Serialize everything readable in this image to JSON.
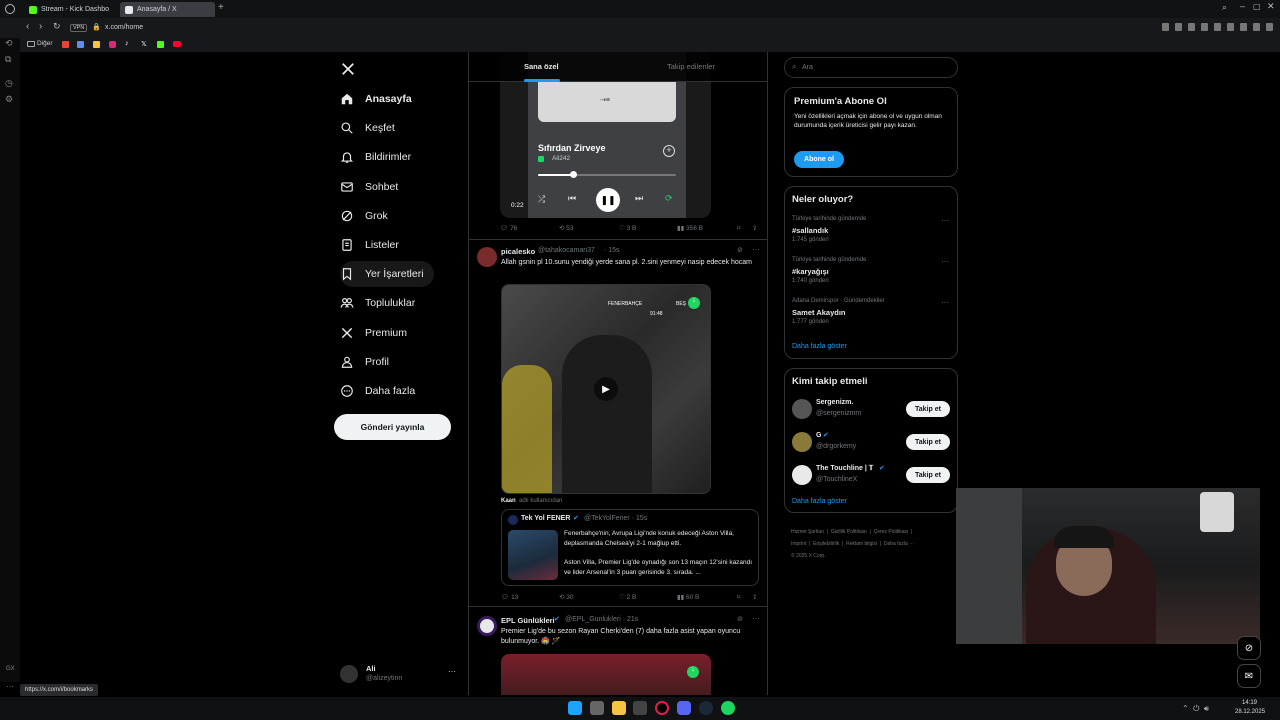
{
  "browser": {
    "tabs": [
      {
        "label": "Stream - Kick Dashbo",
        "favicon_color": "#53fc18"
      },
      {
        "label": "Anasayfa / X",
        "favicon_color": "#e7e9ea"
      }
    ],
    "url": "x.com/home",
    "vpn_badge": "VPN",
    "bookmarks_folder": "Diğer",
    "status_url": "https://x.com/i/bookmarks"
  },
  "nav": {
    "items": [
      {
        "label": "Anasayfa",
        "icon": "home-icon"
      },
      {
        "label": "Keşfet",
        "icon": "search-icon"
      },
      {
        "label": "Bildirimler",
        "icon": "bell-icon"
      },
      {
        "label": "Sohbet",
        "icon": "mail-icon"
      },
      {
        "label": "Grok",
        "icon": "grok-icon"
      },
      {
        "label": "Listeler",
        "icon": "list-icon"
      },
      {
        "label": "Yer İşaretleri",
        "icon": "bookmark-icon"
      },
      {
        "label": "Topluluklar",
        "icon": "people-icon"
      },
      {
        "label": "Premium",
        "icon": "x-logo-icon"
      },
      {
        "label": "Profil",
        "icon": "user-icon"
      },
      {
        "label": "Daha fazla",
        "icon": "more-circle-icon"
      }
    ],
    "post_button": "Gönderi yayınla",
    "account": {
      "name": "Ali",
      "handle": "@alizeytinn"
    }
  },
  "feed": {
    "tabs": [
      "Sana özel",
      "Takip edilenler"
    ],
    "post1": {
      "song_title": "Sıfırdan Zirveye",
      "artist": "Ali242",
      "time": "0:22",
      "stats": {
        "reply": "76",
        "repost": "53",
        "like": "3 B",
        "views": "356 B"
      }
    },
    "post2": {
      "name": "picalesko",
      "handle": "@tahakocaman37",
      "time": "· 15s",
      "text": "Allah gsnin pl 10.sunu yendiği yerde sana pl. 2.sini yenmeyi nasip edecek hocam",
      "scoreboard": "FENERBAHÇE",
      "scoreboard2": "BEŞ",
      "clock": "91:48",
      "attribution_name": "Kaan",
      "attribution_rest": "adlı kullanıcıdan",
      "quote": {
        "name": "Tek Yol FENER",
        "handle": "@TekYolFener · 15s",
        "text1": "Fenerbahçe'nin, Avrupa Ligi'nde konuk edeceği Aston Villa, deplasmanda Chelsea'yi 2-1 mağlup etti.",
        "text2": "Aston Villa, Premier Lig'de oynadığı son 13 maçın 12'sini kazandı ve lider Arsenal'in 3 puan gerisinde 3. sırada. ..."
      },
      "stats": {
        "reply": "13",
        "repost": "30",
        "like": "2 B",
        "views": "60 B"
      }
    },
    "post3": {
      "name": "EPL Günlükleri",
      "handle": "@EPL_Gunlukleri · 21s",
      "text": "Premier Lig'de bu sezon Rayan Cherki'den (7) daha fazla asist yapan oyuncu bulunmuyor. 🏟️ 🪄"
    }
  },
  "sidebar": {
    "search_placeholder": "Ara",
    "premium": {
      "title": "Premium'a Abone Ol",
      "text": "Yeni özellikleri açmak için abone ol ve uygun olman durumunda içerik üreticisi gelir payı kazan.",
      "button": "Abone ol"
    },
    "trends": {
      "title": "Neler oluyor?",
      "items": [
        {
          "context": "Türkiye tarihinde gündemde",
          "name": "#sallandık",
          "count": "1.745 gönderi"
        },
        {
          "context": "Türkiye tarihinde gündemde",
          "name": "#karyağışı",
          "count": "1.740 gönderi"
        },
        {
          "context": "Adana Demirspor · Gündemdekiler",
          "name": "Samet Akaydın",
          "count": "1.777 gönderi"
        }
      ],
      "show_more": "Daha fazla göster"
    },
    "who_to_follow": {
      "title": "Kimi takip etmeli",
      "items": [
        {
          "name": "Sergenizm.",
          "handle": "@sergenizmm",
          "verified": false,
          "button": "Takip et"
        },
        {
          "name": "G",
          "handle": "@drgorkemy",
          "verified": true,
          "button": "Takip et"
        },
        {
          "name": "The Touchline | 𝐓",
          "handle": "@TouchlineX",
          "verified": true,
          "button": "Takip et"
        }
      ],
      "show_more": "Daha fazla göster"
    },
    "footer": [
      "Hizmet Şartları",
      "Gizlilik Politikası",
      "Çerez Politikası",
      "Imprint",
      "Erişilebilirlik",
      "Reklam bilgisi",
      "Daha fazla ···",
      "© 2025 X Corp."
    ]
  },
  "taskbar": {
    "time": "14:19",
    "date": "28.12.2025"
  },
  "colors": {
    "accent": "#1d9bf0",
    "bg": "#000000",
    "border": "#2f3336",
    "muted": "#71767b"
  }
}
